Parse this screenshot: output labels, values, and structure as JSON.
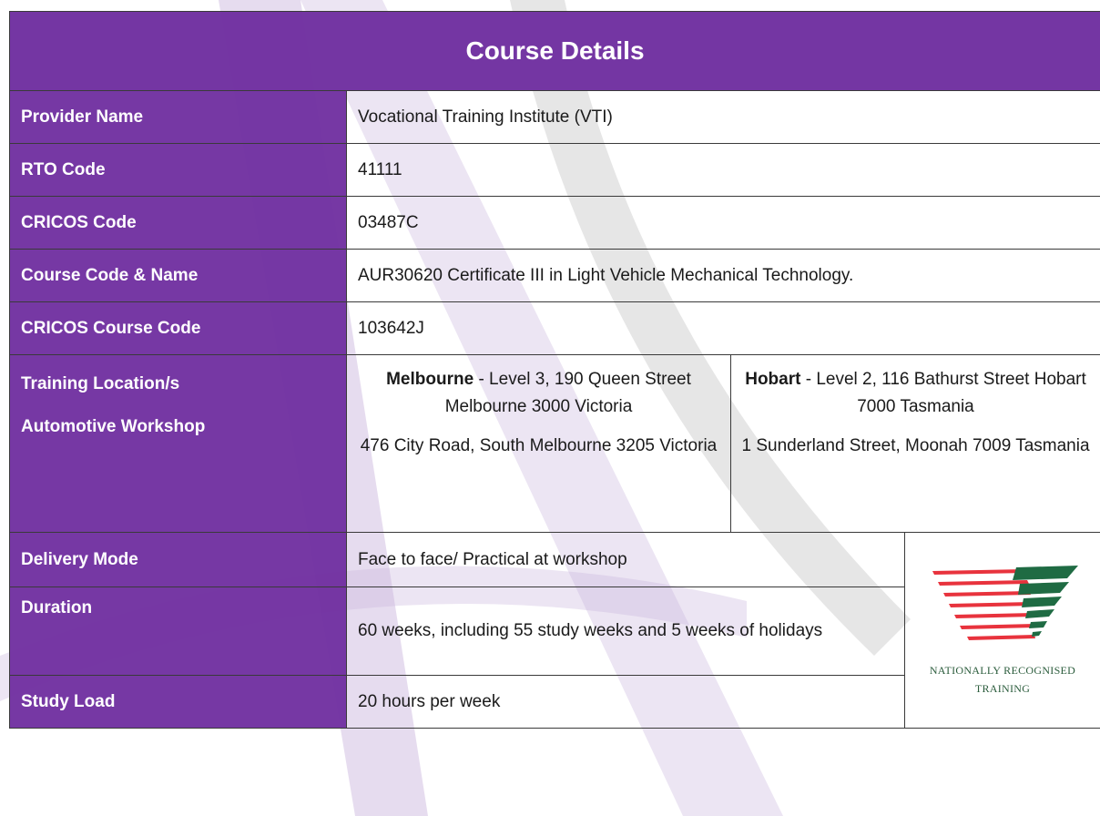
{
  "title": "Course Details",
  "rows": [
    {
      "label": "Provider Name",
      "value": "Vocational Training Institute (VTI)"
    },
    {
      "label": "RTO Code",
      "value": "41111"
    },
    {
      "label": "CRICOS Code",
      "value": "03487C"
    },
    {
      "label": "Course Code & Name",
      "value": "AUR30620 Certificate III in Light Vehicle Mechanical Technology."
    },
    {
      "label": "CRICOS Course Code",
      "value": "103642J"
    }
  ],
  "training": {
    "label_line1": "Training Location/s",
    "label_line2": "Automotive Workshop",
    "melbourne": {
      "name": "Melbourne",
      "address": " - Level 3, 190 Queen Street Melbourne 3000 Victoria",
      "workshop": "476 City Road, South Melbourne 3205 Victoria"
    },
    "hobart": {
      "name": "Hobart",
      "address": " - Level 2, 116 Bathurst Street Hobart 7000 Tasmania",
      "workshop": "1 Sunderland Street, Moonah 7009 Tasmania"
    }
  },
  "delivery": {
    "label": "Delivery Mode",
    "value": "Face to face/ Practical at workshop"
  },
  "duration": {
    "label": "Duration",
    "value": "60 weeks, including 55 study weeks and 5 weeks of holidays"
  },
  "study_load": {
    "label": "Study Load",
    "value": "20 hours per week"
  },
  "logo": {
    "line1": "Nationally Recognised",
    "line2": "Training",
    "colors": {
      "red": "#e8333d",
      "green": "#1f6b43",
      "text": "#2b5c3c"
    }
  },
  "theme": {
    "purple": "#7030a0",
    "border": "#3a3a3a"
  }
}
